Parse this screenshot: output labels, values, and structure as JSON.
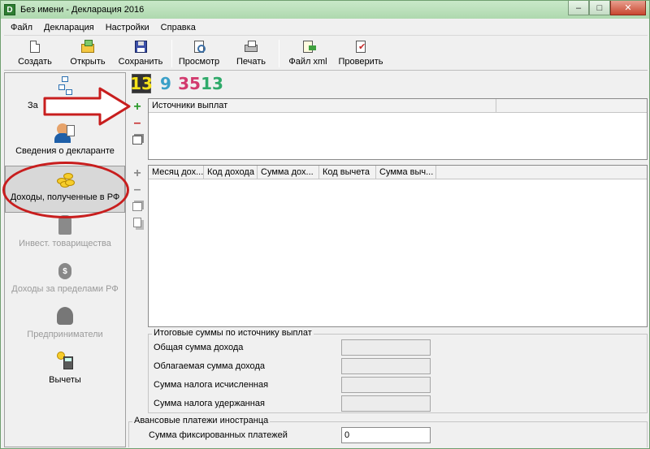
{
  "window": {
    "title": "Без имени - Декларация 2016",
    "app_icon_letter": "D",
    "controls": {
      "minimize": "–",
      "maximize": "□",
      "close": "✕"
    }
  },
  "menu": {
    "items": [
      "Файл",
      "Декларация",
      "Настройки",
      "Справка"
    ]
  },
  "toolbar": {
    "create_label": "Создать",
    "open_label": "Открыть",
    "save_label": "Сохранить",
    "preview_label": "Просмотр",
    "print_label": "Печать",
    "xml_label": "Файл xml",
    "check_label": "Проверить"
  },
  "nav": {
    "items": [
      {
        "label": "За",
        "icon": "tree-icon"
      },
      {
        "label": "Сведения о декларанте",
        "icon": "declarant-icon"
      },
      {
        "label": "Доходы, полученные в РФ",
        "icon": "coins-icon"
      },
      {
        "label": "Инвест. товарищества",
        "icon": "investor-icon"
      },
      {
        "label": "Доходы за пределами РФ",
        "icon": "money-bag-icon"
      },
      {
        "label": "Предприниматели",
        "icon": "entrepreneur-icon"
      },
      {
        "label": "Вычеты",
        "icon": "calculator-icon"
      }
    ]
  },
  "rates": [
    "13",
    "9",
    "35",
    "13"
  ],
  "colors": {
    "rate_13_active": "#f6e31a",
    "rate_9": "#3aa0c8",
    "rate_35": "#d23a6e",
    "rate_13": "#2faa6a",
    "annotation": "#c81e1e"
  },
  "sources_table": {
    "columns": [
      "Источники выплат"
    ]
  },
  "income_table": {
    "columns": [
      "Месяц дох...",
      "Код дохода",
      "Сумма дох...",
      "Код вычета",
      "Сумма выч..."
    ]
  },
  "tools": {
    "add": "+",
    "remove": "–"
  },
  "totals": {
    "title": "Итоговые суммы по источнику выплат",
    "total_income": "Общая сумма дохода",
    "taxable_income": "Облагаемая сумма дохода",
    "tax_calculated": "Сумма налога исчисленная",
    "tax_withheld": "Сумма налога удержанная"
  },
  "advance": {
    "title": "Авансовые платежи иностранца",
    "fixed_label": "Сумма фиксированных платежей",
    "fixed_value": "0"
  }
}
